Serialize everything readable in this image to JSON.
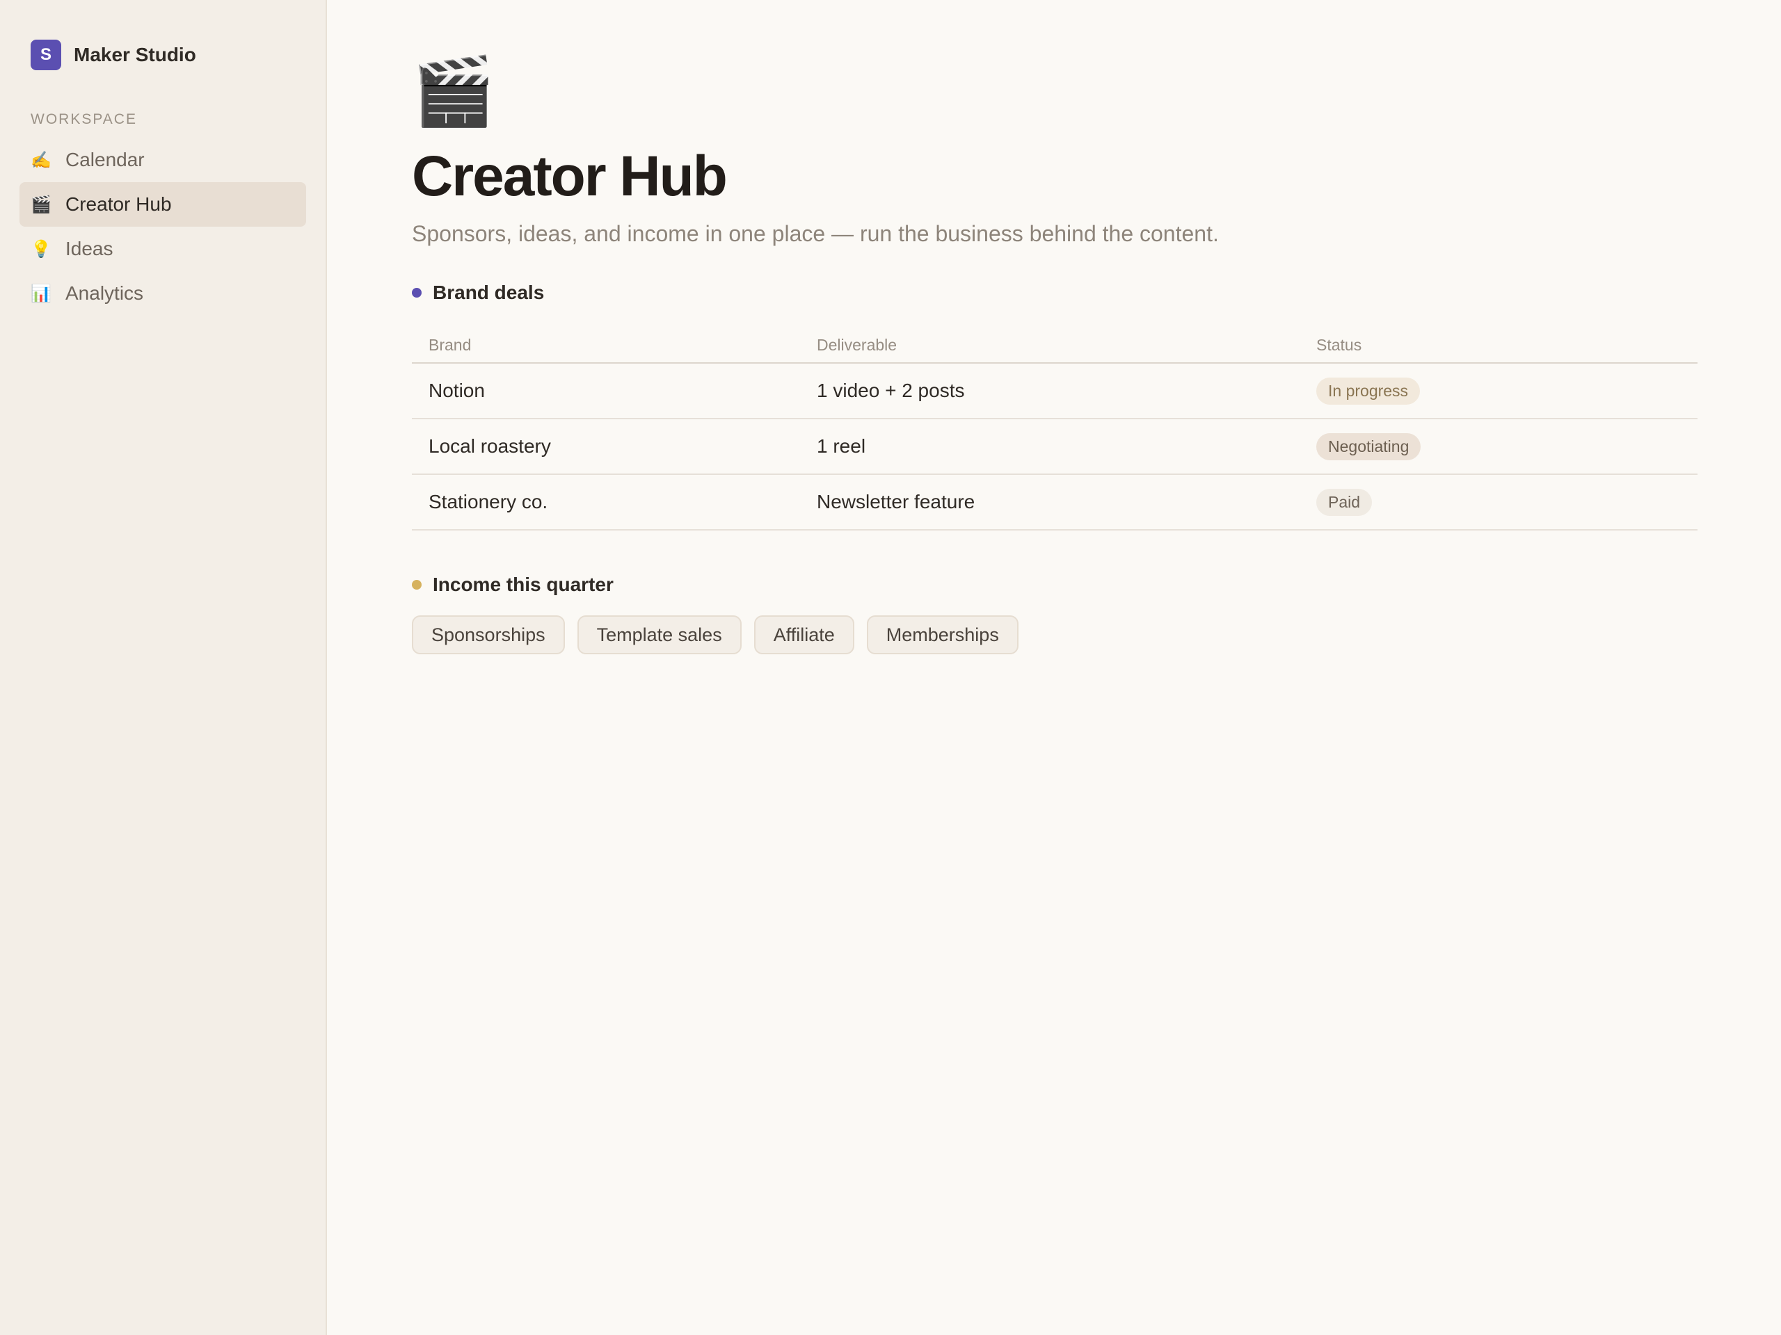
{
  "workspace": {
    "avatar_letter": "S",
    "name": "Maker Studio",
    "brand_color": "#5b4fb1"
  },
  "sidebar": {
    "section_label": "WORKSPACE",
    "items": [
      {
        "label": "Calendar",
        "icon": "✍️",
        "icon_name": "writing-hand-icon",
        "active": false
      },
      {
        "label": "Creator Hub",
        "icon": "🎬",
        "icon_name": "clapper-board-icon",
        "active": true
      },
      {
        "label": "Ideas",
        "icon": "💡",
        "icon_name": "light-bulb-icon",
        "active": false
      },
      {
        "label": "Analytics",
        "icon": "📊",
        "icon_name": "bar-chart-icon",
        "active": false
      }
    ]
  },
  "page": {
    "icon": "🎬",
    "title": "Creator Hub",
    "subtitle": "Sponsors, ideas, and income in one place — run the business behind the content."
  },
  "brand_deals": {
    "heading": "Brand deals",
    "dot_color": "#5b4fb1",
    "columns": [
      "Brand",
      "Deliverable",
      "Status"
    ],
    "rows": [
      {
        "brand": "Notion",
        "deliverable": "1 video + 2 posts",
        "status": "In progress"
      },
      {
        "brand": "Local roastery",
        "deliverable": "1 reel",
        "status": "Negotiating"
      },
      {
        "brand": "Stationery co.",
        "deliverable": "Newsletter feature",
        "status": "Paid"
      }
    ]
  },
  "income": {
    "heading": "Income this quarter",
    "dot_color": "#d6b25e",
    "chips": [
      "Sponsorships",
      "Template sales",
      "Affiliate",
      "Memberships"
    ]
  }
}
